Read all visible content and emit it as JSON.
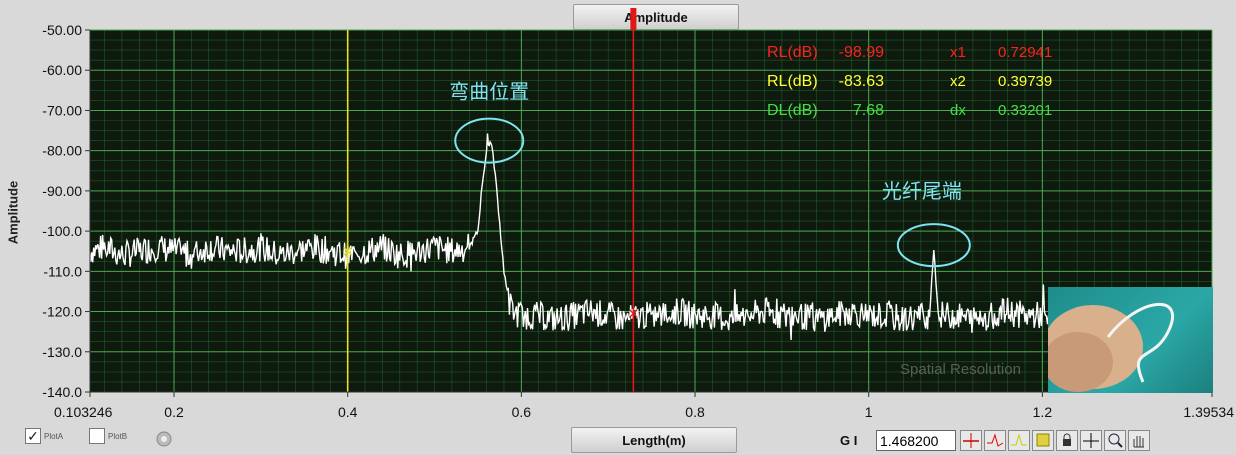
{
  "title": "Amplitude",
  "xlabel": "Length(m)",
  "ylabel": "Amplitude",
  "chart_data": {
    "type": "line",
    "xlim": [
      0.103246,
      1.39534
    ],
    "ylim": [
      -140,
      -50
    ],
    "x_ticks": [
      {
        "value": 0.103246,
        "label": "0.103246"
      },
      {
        "value": 0.2,
        "label": "0.2"
      },
      {
        "value": 0.4,
        "label": "0.4"
      },
      {
        "value": 0.6,
        "label": "0.6"
      },
      {
        "value": 0.8,
        "label": "0.8"
      },
      {
        "value": 1.0,
        "label": "1"
      },
      {
        "value": 1.2,
        "label": "1.2"
      },
      {
        "value": 1.39534,
        "label": "1.39534"
      }
    ],
    "y_ticks": [
      {
        "value": -50,
        "label": "-50.00"
      },
      {
        "value": -60,
        "label": "-60.00"
      },
      {
        "value": -70,
        "label": "-70.00"
      },
      {
        "value": -80,
        "label": "-80.00"
      },
      {
        "value": -90,
        "label": "-90.00"
      },
      {
        "value": -100,
        "label": "-100.0"
      },
      {
        "value": -110,
        "label": "-110.0"
      },
      {
        "value": -120,
        "label": "-120.0"
      },
      {
        "value": -130,
        "label": "-130.0"
      },
      {
        "value": -140,
        "label": "-140.0"
      }
    ],
    "grid": true,
    "series": [
      {
        "color": "#ffffff",
        "x": [
          0.103,
          0.12,
          0.14,
          0.16,
          0.18,
          0.2,
          0.22,
          0.24,
          0.26,
          0.28,
          0.3,
          0.32,
          0.34,
          0.36,
          0.38,
          0.4,
          0.42,
          0.44,
          0.46,
          0.48,
          0.5,
          0.52,
          0.54,
          0.55,
          0.555,
          0.56,
          0.563,
          0.566,
          0.57,
          0.575,
          0.58,
          0.585,
          0.59,
          0.6,
          0.62,
          0.64,
          0.66,
          0.68,
          0.7,
          0.72,
          0.74,
          0.76,
          0.78,
          0.8,
          0.82,
          0.84,
          0.86,
          0.88,
          0.9,
          0.92,
          0.94,
          0.96,
          0.98,
          1.0,
          1.02,
          1.04,
          1.06,
          1.07,
          1.075,
          1.08,
          1.1,
          1.12,
          1.14,
          1.16,
          1.18,
          1.2,
          1.22,
          1.24,
          1.26
        ],
        "y": [
          -105,
          -104,
          -106,
          -105,
          -104,
          -105,
          -106,
          -104,
          -105,
          -105,
          -104,
          -106,
          -105,
          -104,
          -105,
          -106,
          -105,
          -104,
          -106,
          -105,
          -104,
          -105,
          -104,
          -100,
          -88,
          -80,
          -77,
          -79,
          -86,
          -98,
          -110,
          -117,
          -120,
          -121,
          -121,
          -122,
          -121,
          -120,
          -121,
          -122,
          -121,
          -121,
          -120,
          -121,
          -121,
          -122,
          -121,
          -120,
          -121,
          -121,
          -122,
          -121,
          -120,
          -121,
          -121,
          -122,
          -121,
          -121,
          -104,
          -121,
          -121,
          -122,
          -121,
          -120,
          -121,
          -121,
          -122,
          -121,
          -121
        ]
      }
    ],
    "cursors": [
      {
        "x": 0.4,
        "color": "#e8e020",
        "y": -105
      },
      {
        "x": 0.729,
        "color": "#e01818",
        "y": -120.5
      }
    ],
    "readouts": [
      {
        "label": "RL(dB)",
        "value": "-98.99",
        "color": "#ff2020",
        "x_label": "x1",
        "x_value": "0.72941"
      },
      {
        "label": "RL(dB)",
        "value": "-83.63",
        "color": "#ffff30",
        "x_label": "x2",
        "x_value": "0.39739"
      },
      {
        "label": "DL(dB)",
        "value": "7.68",
        "color": "#40e040",
        "x_label": "dx",
        "x_value": "0.33201"
      }
    ],
    "annotations": [
      {
        "text": "弯曲位置",
        "x": 0.563,
        "y": -77
      },
      {
        "text": "光纤尾端",
        "x": 1.075,
        "y": -103
      }
    ],
    "watermark": "Spatial Resolution"
  },
  "plot_toggles": [
    {
      "label": "PlotA",
      "checked": true
    },
    {
      "label": "PlotB",
      "checked": false
    }
  ],
  "gi_label": "G I",
  "gi_value": "1.468200",
  "annotation_color": "#7fe3f0",
  "plot_bg": "#0e1a0e",
  "grid_color": "#2f8a3a"
}
